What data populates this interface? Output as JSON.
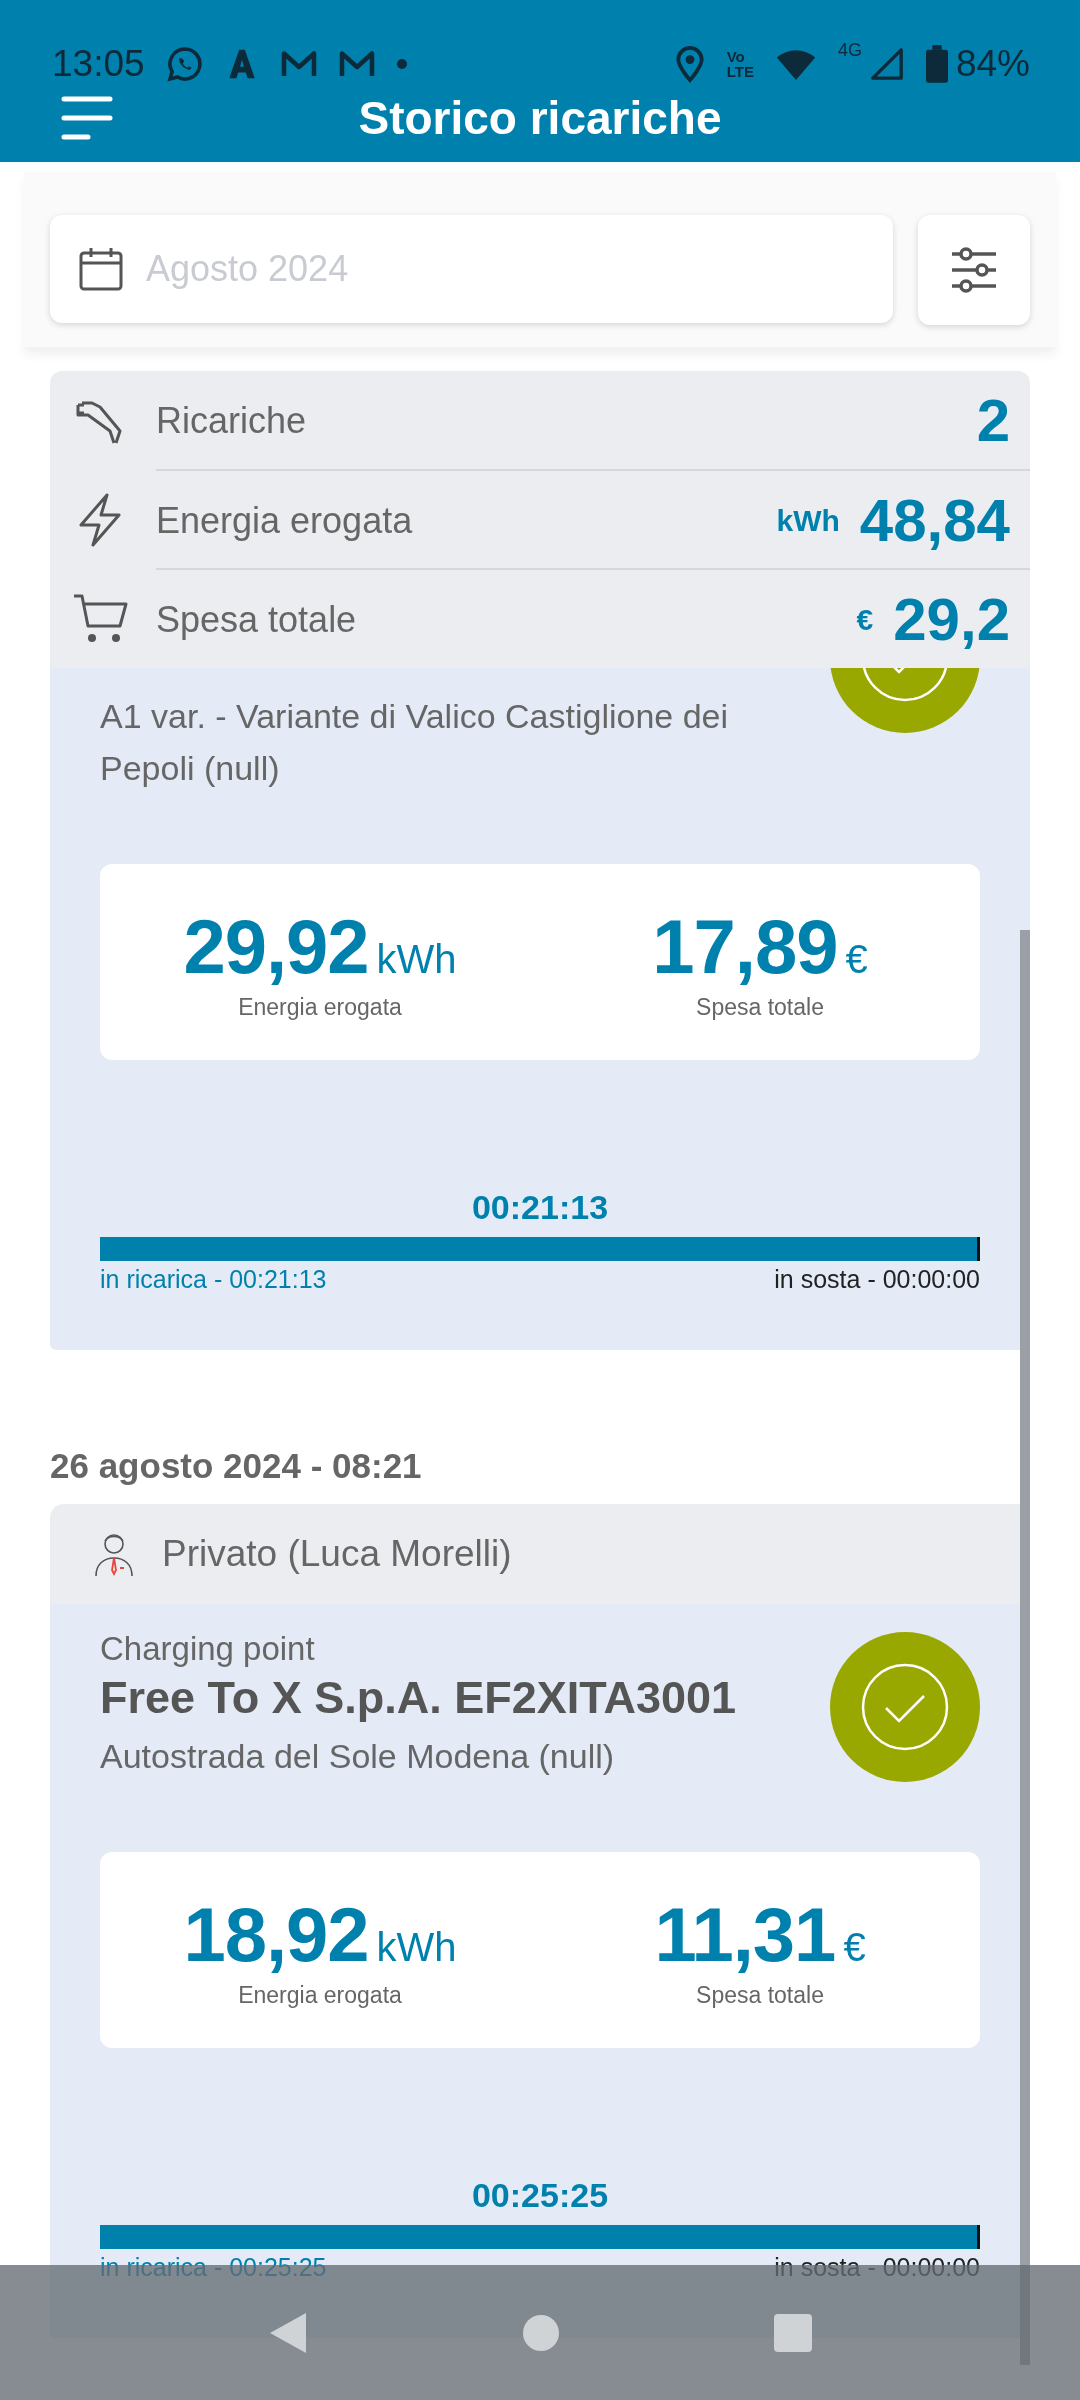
{
  "status_bar": {
    "time": "13:05",
    "volte": [
      "Vo",
      "LTE"
    ],
    "network": "4G",
    "battery": "84%"
  },
  "app_bar": {
    "title": "Storico ricariche"
  },
  "filter": {
    "placeholder": "Agosto 2024"
  },
  "summary": [
    {
      "kind": "plug",
      "label": "Ricariche",
      "value": "2"
    },
    {
      "kind": "bolt",
      "label": "Energia erogata",
      "unit": "kWh",
      "value": "48,84"
    },
    {
      "kind": "cart",
      "label": "Spesa totale",
      "unit": "€",
      "value": "29,2"
    }
  ],
  "sessions": [
    {
      "address": "A1 var. - Variante di Valico Castiglione dei Pepoli (null)",
      "completed": true,
      "energy": {
        "value": "29,92",
        "unit": "kWh",
        "label": "Energia erogata"
      },
      "cost": {
        "value": "17,89",
        "unit": "€",
        "label": "Spesa totale"
      },
      "duration": "00:21:13",
      "charging": "in ricarica - 00:21:13",
      "parking": "in sosta - 00:00:00",
      "level": 1
    },
    {
      "date": "26 agosto 2024 - 08:21",
      "customer": "Privato (Luca Morelli)",
      "type_label": "Charging point",
      "station": "Free To X S.p.A. EF2XITA3001",
      "address": "Autostrada del Sole Modena (null)",
      "completed": true,
      "energy": {
        "value": "18,92",
        "unit": "kWh",
        "label": "Energia erogata"
      },
      "cost": {
        "value": "11,31",
        "unit": "€",
        "label": "Spesa totale"
      },
      "duration": "00:25:25",
      "charging": "in ricarica - 00:25:25",
      "parking": "in sosta - 00:00:00",
      "level": 1
    }
  ]
}
